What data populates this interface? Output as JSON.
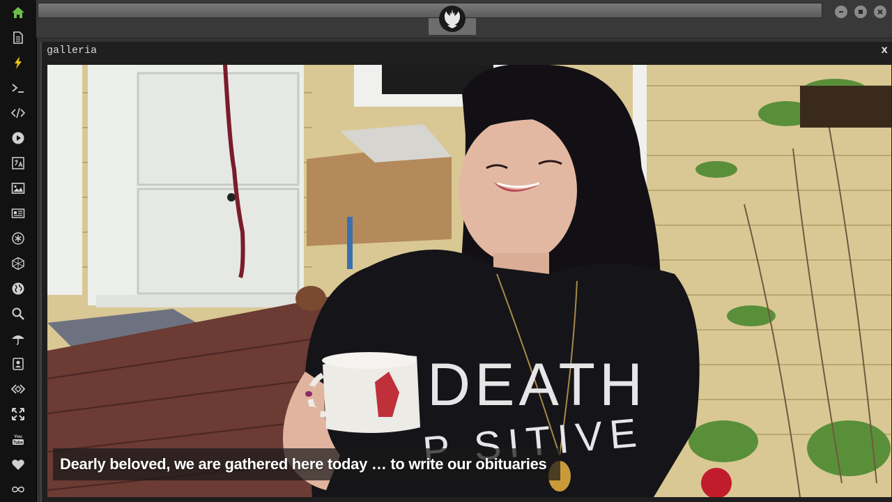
{
  "colors": {
    "sidebar_bg": "#121212",
    "active_icon": "#6bbf4a",
    "icon": "#d0d0d0",
    "flash_icon": "#f0c419"
  },
  "sidebar": {
    "items": [
      {
        "name": "home-icon",
        "active": true
      },
      {
        "name": "document-icon"
      },
      {
        "name": "flash-icon"
      },
      {
        "name": "terminal-icon"
      },
      {
        "name": "code-icon"
      },
      {
        "name": "play-icon"
      },
      {
        "name": "translate-icon"
      },
      {
        "name": "image-icon"
      },
      {
        "name": "news-icon"
      },
      {
        "name": "asterisk-icon"
      },
      {
        "name": "hexagon-icon"
      },
      {
        "name": "globe-icon"
      },
      {
        "name": "search-icon"
      },
      {
        "name": "umbrella-icon"
      },
      {
        "name": "contact-icon"
      },
      {
        "name": "embed-icon"
      },
      {
        "name": "expand-icon"
      },
      {
        "name": "youtube-icon"
      },
      {
        "name": "heart-icon"
      },
      {
        "name": "infinity-icon"
      }
    ]
  },
  "topbar": {
    "logo": "rebel-alliance-icon",
    "window_controls": [
      "minimize-icon",
      "maximize-icon",
      "close-icon"
    ]
  },
  "gallery": {
    "title": "galleria",
    "close_label": "x",
    "caption": "Dearly beloved, we are gathered here today … to write our obituaries",
    "shirt_text_line1": "DEATH",
    "shirt_text_line2": "P  SITIVE"
  }
}
